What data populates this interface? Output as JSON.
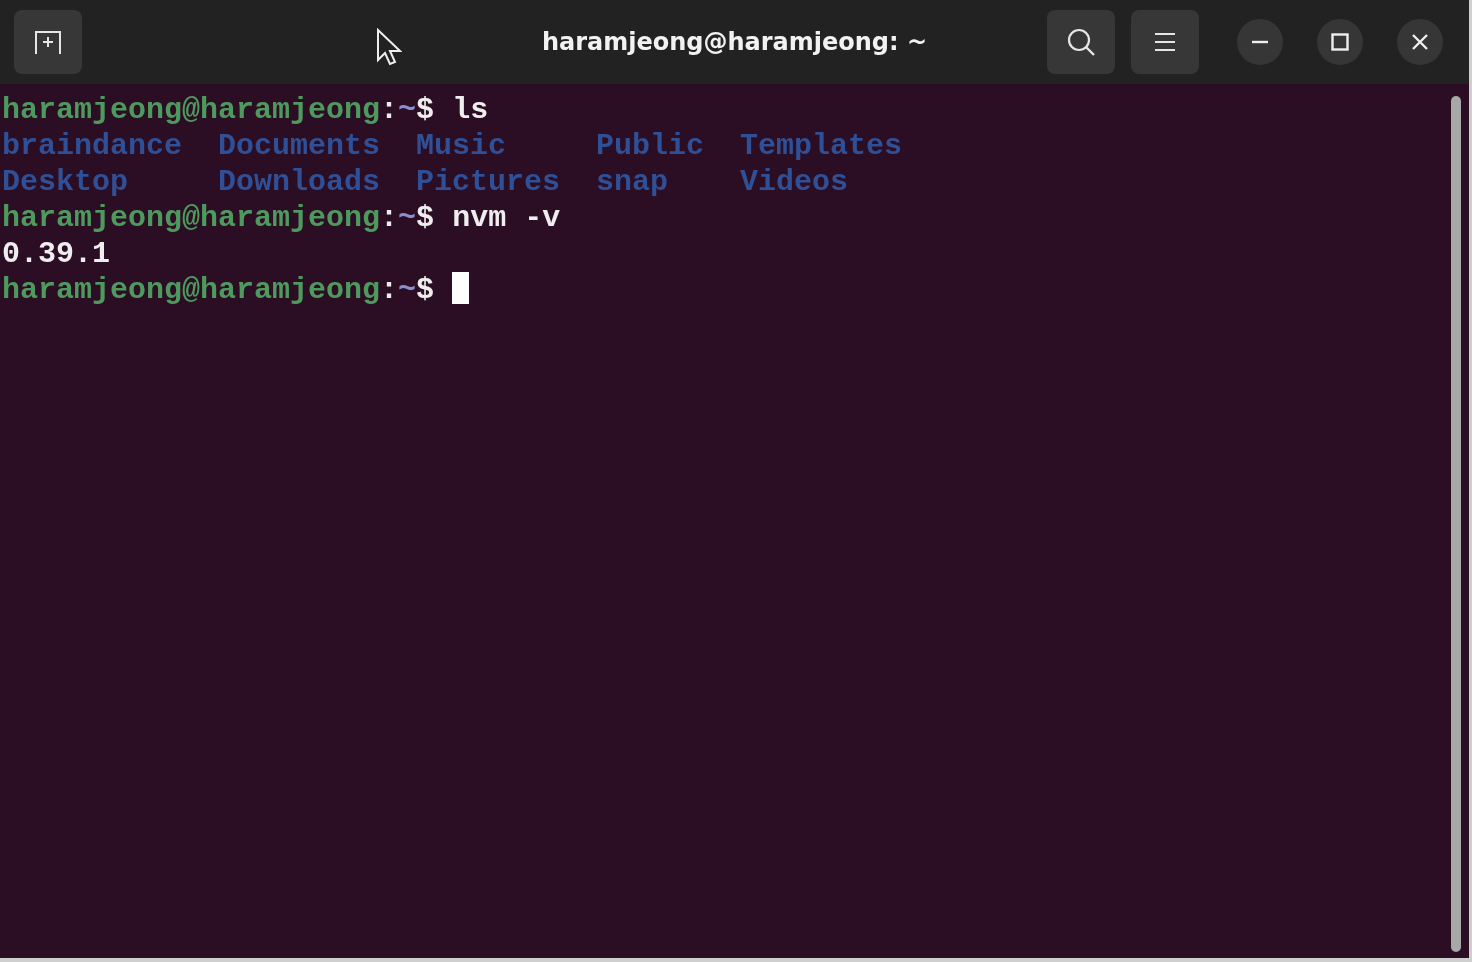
{
  "window": {
    "title": "haramjeong@haramjeong: ~"
  },
  "terminal": {
    "lines": [
      {
        "kind": "prompt",
        "user_host": "haramjeong@haramjeong",
        "separator": ":",
        "path": "~",
        "symbol": "$",
        "command": "ls"
      },
      {
        "kind": "listing",
        "rows": [
          [
            "braindance",
            "Documents",
            "Music",
            "Public",
            "Templates"
          ],
          [
            "Desktop",
            "Downloads",
            "Pictures",
            "snap",
            "Videos"
          ]
        ]
      },
      {
        "kind": "prompt",
        "user_host": "haramjeong@haramjeong",
        "separator": ":",
        "path": "~",
        "symbol": "$",
        "command": "nvm -v"
      },
      {
        "kind": "output",
        "text": "0.39.1"
      },
      {
        "kind": "prompt",
        "user_host": "haramjeong@haramjeong",
        "separator": ":",
        "path": "~",
        "symbol": "$",
        "cursor": true
      }
    ]
  }
}
